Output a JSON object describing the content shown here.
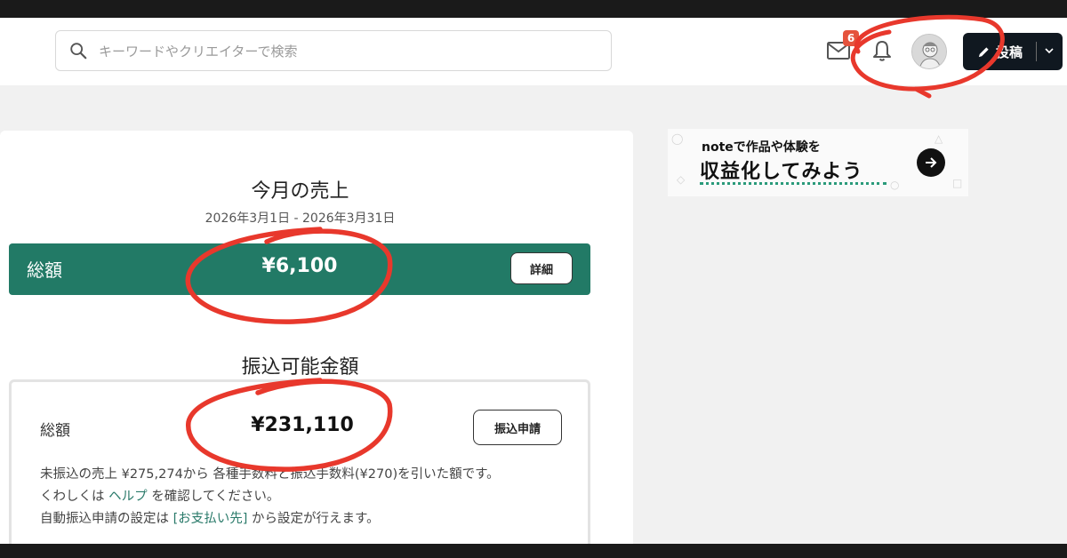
{
  "header": {
    "search": {
      "placeholder": "キーワードやクリエイターで検索",
      "icon": "search-icon"
    },
    "mail": {
      "icon": "mail-icon",
      "badge_count": "6"
    },
    "bell": {
      "icon": "bell-icon"
    },
    "post_button": {
      "label": "投稿",
      "icon": "pencil-icon"
    }
  },
  "sales": {
    "title": "今月の売上",
    "period": "2026年3月1日 - 2026年3月31日",
    "total_label": "総額",
    "total_amount": "¥6,100",
    "detail_label": "詳細"
  },
  "transfer": {
    "title": "振込可能金額",
    "total_label": "総額",
    "total_amount": "¥231,110",
    "apply_label": "振込申請",
    "note_line1": "未振込の売上 ¥275,274から 各種手数料と振込手数料(¥270)を引いた額です。",
    "note_line2_before": "くわしくは",
    "note_line2_link": "ヘルプ",
    "note_line2_after": "を確認してください。",
    "note_line3_before": "自動振込申請の設定は",
    "note_line3_link": "[お支払い先]",
    "note_line3_after": "から設定が行えます。"
  },
  "banner": {
    "subtitle": "noteで作品や体験を",
    "title": "収益化してみよう",
    "icon": "arrow-right-icon"
  },
  "colors": {
    "accent_green": "#227a66",
    "link_green": "#2a7a6a",
    "badge_red": "#e5533d",
    "annotation_red": "#e8382c"
  }
}
